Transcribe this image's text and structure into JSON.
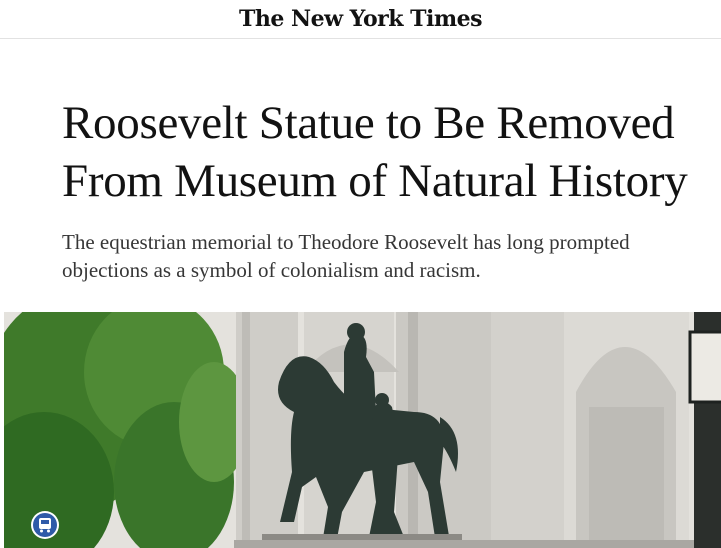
{
  "masthead": {
    "logo_text": "The New York Times"
  },
  "article": {
    "headline": "Roosevelt Statue to Be Removed From Museum of Natural History",
    "summary": "The equestrian memorial to Theodore Roosevelt has long prompted objections as a symbol of colonialism and racism."
  },
  "hero_image": {
    "subject": "equestrian-statue-photo"
  },
  "colors": {
    "text": "#121212",
    "summary_text": "#363636",
    "rule": "#e2e2e2",
    "stone": "#d9d7d2",
    "bronze": "#2c3a34",
    "foliage": "#3f7a2a"
  }
}
